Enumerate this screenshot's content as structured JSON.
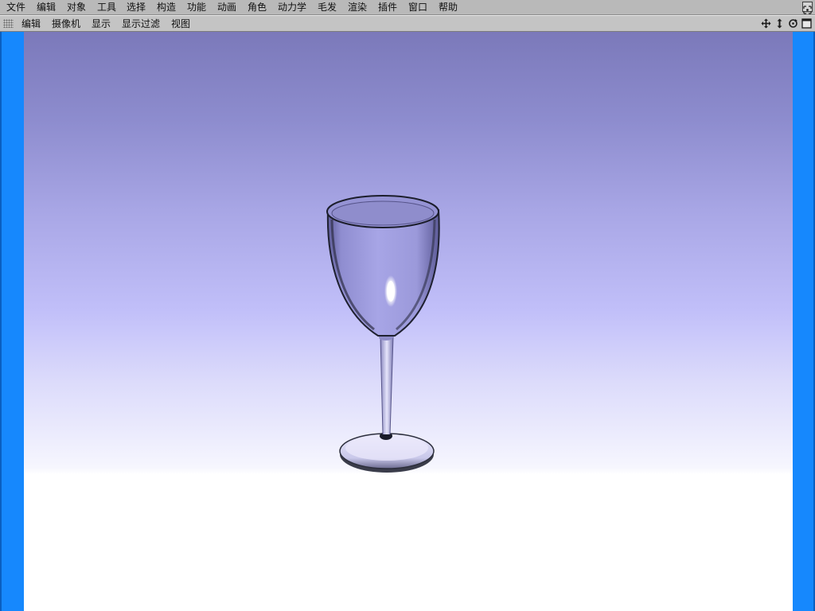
{
  "menubar": {
    "items": [
      "文件",
      "编辑",
      "对象",
      "工具",
      "选择",
      "构造",
      "功能",
      "动画",
      "角色",
      "动力学",
      "毛发",
      "渲染",
      "插件",
      "窗口",
      "帮助"
    ]
  },
  "viewport_toolbar": {
    "items": [
      "编辑",
      "摄像机",
      "显示",
      "显示过滤",
      "视图"
    ],
    "nav_icons": [
      "move-view-icon",
      "zoom-view-icon",
      "rotate-view-icon",
      "maximize-view-icon"
    ]
  },
  "colors": {
    "menubar_bg": "#b9b9b9",
    "toolbar_bg": "#c4c4c4",
    "viewport_side_bar": "#1688fd",
    "sky_top": "#7b79ba",
    "sky_horizon": "#c1bff9",
    "floor": "#ffffff"
  },
  "scene": {
    "object": "wine-glass"
  }
}
